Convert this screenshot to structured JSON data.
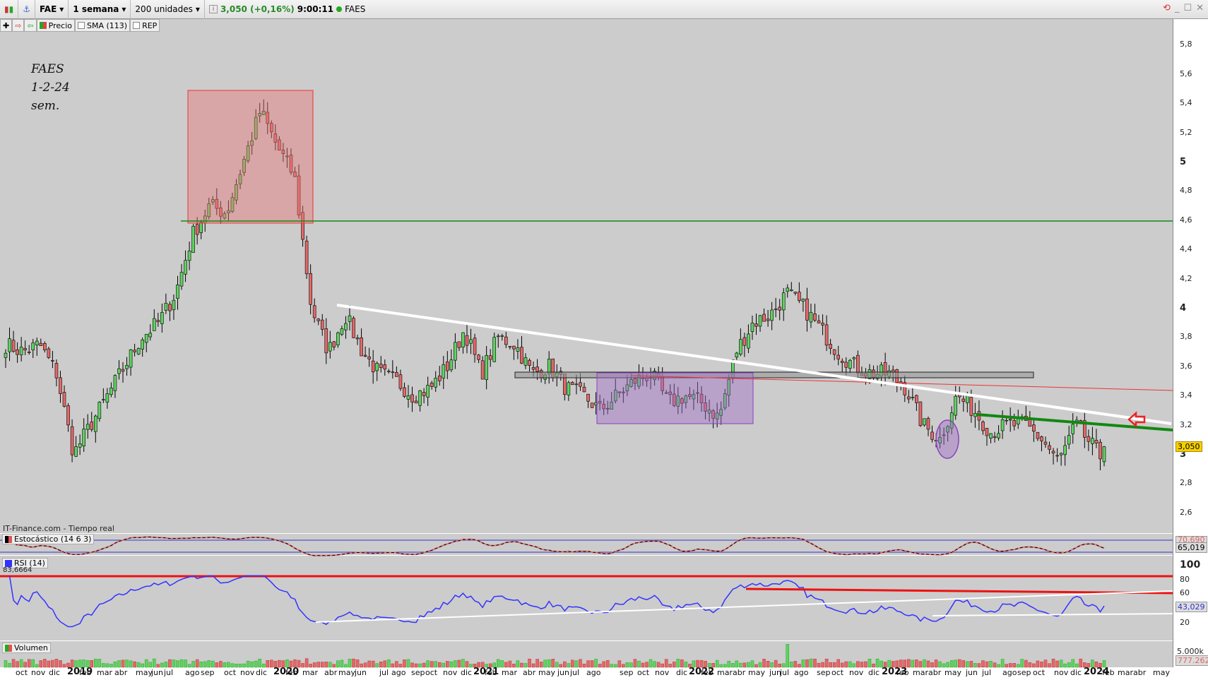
{
  "header": {
    "symbol": "FAE",
    "period": "1 semana",
    "units": "200 unidades",
    "price_info": "3,050 (+0,16%)",
    "time": "9:00:11",
    "name": "FAES"
  },
  "toolbar": {
    "price_label": "Precio",
    "sma_label": "SMA (113)",
    "rep_label": "REP"
  },
  "note": {
    "line1": "FAES",
    "line2": "1-2-24",
    "line3": "sem."
  },
  "source_label": "IT-Finance.com - Tiempo real",
  "panes": {
    "stochastic": {
      "label": "Estocástico (14 6 3)",
      "value_k": "70,690",
      "value_d": "65,019"
    },
    "rsi": {
      "label": "RSI (14)",
      "max_value": "83,6664",
      "value": "43,029",
      "ticks": [
        "100",
        "80",
        "60",
        "20"
      ]
    },
    "volume": {
      "label": "Volumen",
      "tick": "5.000k",
      "value": "777.262"
    }
  },
  "price_axis": {
    "ticks": [
      "5,8",
      "5,6",
      "5,4",
      "5,2",
      "5",
      "4,8",
      "4,6",
      "4,4",
      "4,2",
      "4",
      "3,8",
      "3,6",
      "3,4",
      "3,2",
      "3",
      "2,8",
      "2,6"
    ],
    "last_price": "3,050"
  },
  "time_axis": [
    "oct",
    "nov",
    "dic",
    "2019",
    "feb",
    "mar",
    "abr",
    "may",
    "jun",
    "jul",
    "ago",
    "sep",
    "oct",
    "nov",
    "dic",
    "2020",
    "feb",
    "mar",
    "abr",
    "may",
    "jun",
    "jul",
    "ago",
    "sep",
    "oct",
    "nov",
    "dic",
    "2021",
    "feb",
    "mar",
    "abr",
    "may",
    "jun",
    "jul",
    "ago",
    "sep",
    "oct",
    "nov",
    "dic",
    "2022",
    "feb",
    "mar",
    "abr",
    "may",
    "jun",
    "jul",
    "ago",
    "sep",
    "oct",
    "nov",
    "dic",
    "2023",
    "feb",
    "mar",
    "abr",
    "may",
    "jun",
    "jul",
    "ago",
    "sep",
    "oct",
    "nov",
    "dic",
    "2024",
    "feb",
    "mar",
    "abr",
    "may"
  ],
  "colors": {
    "up": "#5fd35f",
    "down": "#e46868",
    "background": "#cccccc",
    "support": "#118811",
    "trendline": "#ffffff",
    "rsi": "#3333ff"
  },
  "chart_data": {
    "type": "candlestick",
    "interval": "weekly",
    "start": "sep 2018",
    "monthly_close": [
      3.75,
      3.7,
      3.75,
      3.55,
      3.0,
      3.2,
      3.4,
      3.6,
      3.8,
      3.9,
      4.1,
      4.5,
      4.7,
      4.65,
      5.0,
      5.35,
      5.1,
      4.9,
      4.0,
      3.7,
      3.95,
      3.7,
      3.55,
      3.5,
      3.4,
      3.45,
      3.6,
      3.85,
      3.55,
      3.8,
      3.75,
      3.55,
      3.6,
      3.45,
      3.4,
      3.3,
      3.4,
      3.5,
      3.55,
      3.35,
      3.4,
      3.35,
      3.25,
      3.7,
      3.9,
      3.95,
      4.1,
      4.0,
      3.85,
      3.7,
      3.6,
      3.55,
      3.55,
      3.45,
      3.2,
      3.1,
      3.4,
      3.3,
      3.15,
      3.2,
      3.2,
      3.1,
      2.95,
      3.2,
      3.05
    ],
    "levels": {
      "resistance": 4.6
    }
  }
}
